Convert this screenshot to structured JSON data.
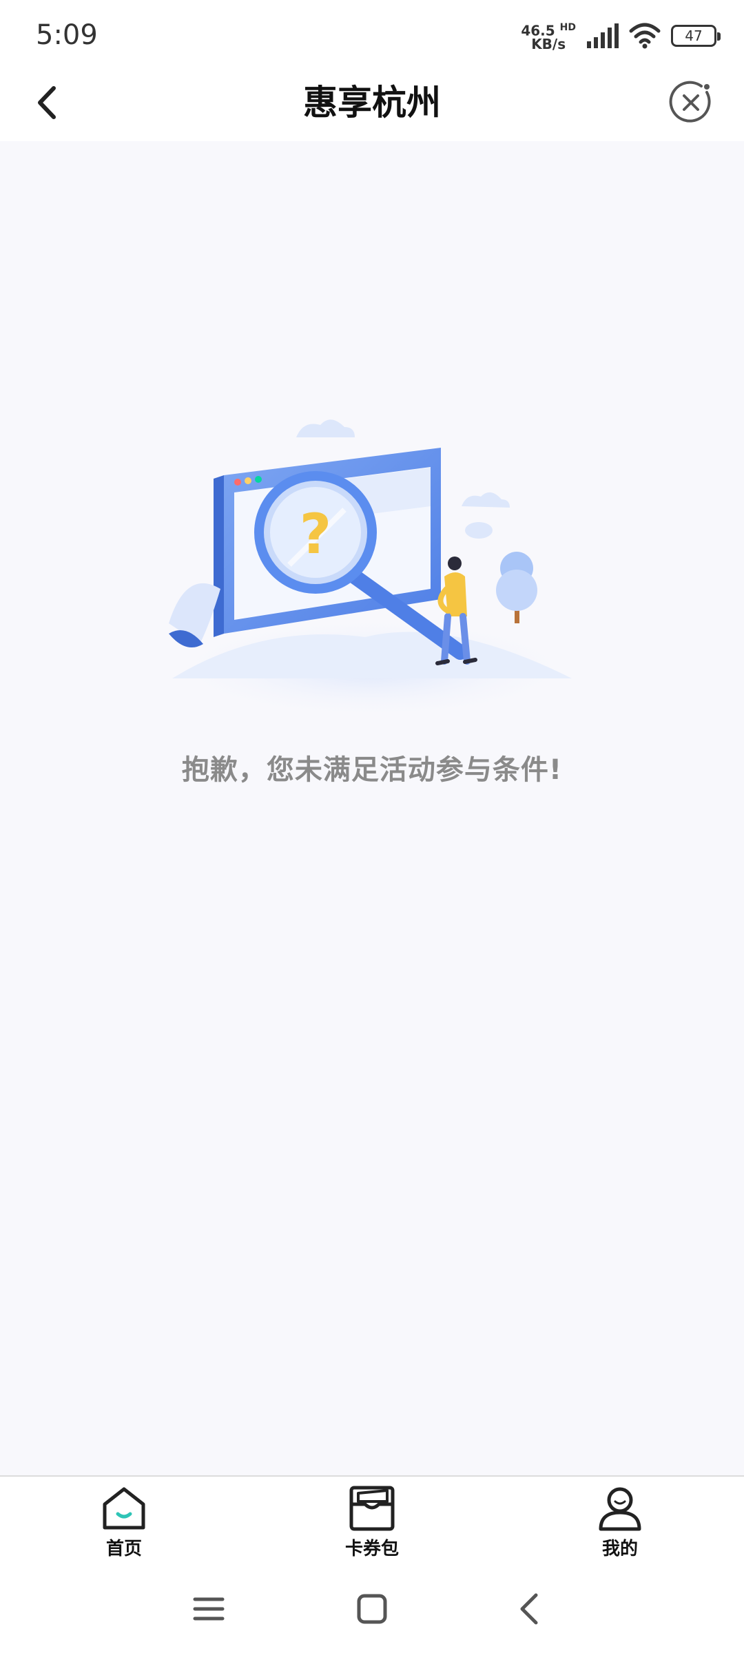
{
  "status_bar": {
    "time": "5:09",
    "net_speed_value": "46.5",
    "net_speed_unit": "KB/s",
    "hd_label": "HD",
    "battery": "47"
  },
  "nav": {
    "title": "惠享杭州"
  },
  "content": {
    "message": "抱歉，您未满足活动参与条件!"
  },
  "tabs": [
    {
      "label": "首页",
      "icon": "home-icon"
    },
    {
      "label": "卡券包",
      "icon": "wallet-icon"
    },
    {
      "label": "我的",
      "icon": "user-icon"
    }
  ],
  "colors": {
    "accent": "#2ec4b6",
    "illustration_blue": "#5b8def",
    "figure_yellow": "#f5c542",
    "background": "#f8f8fc",
    "message_gray": "#8a8a8a"
  }
}
